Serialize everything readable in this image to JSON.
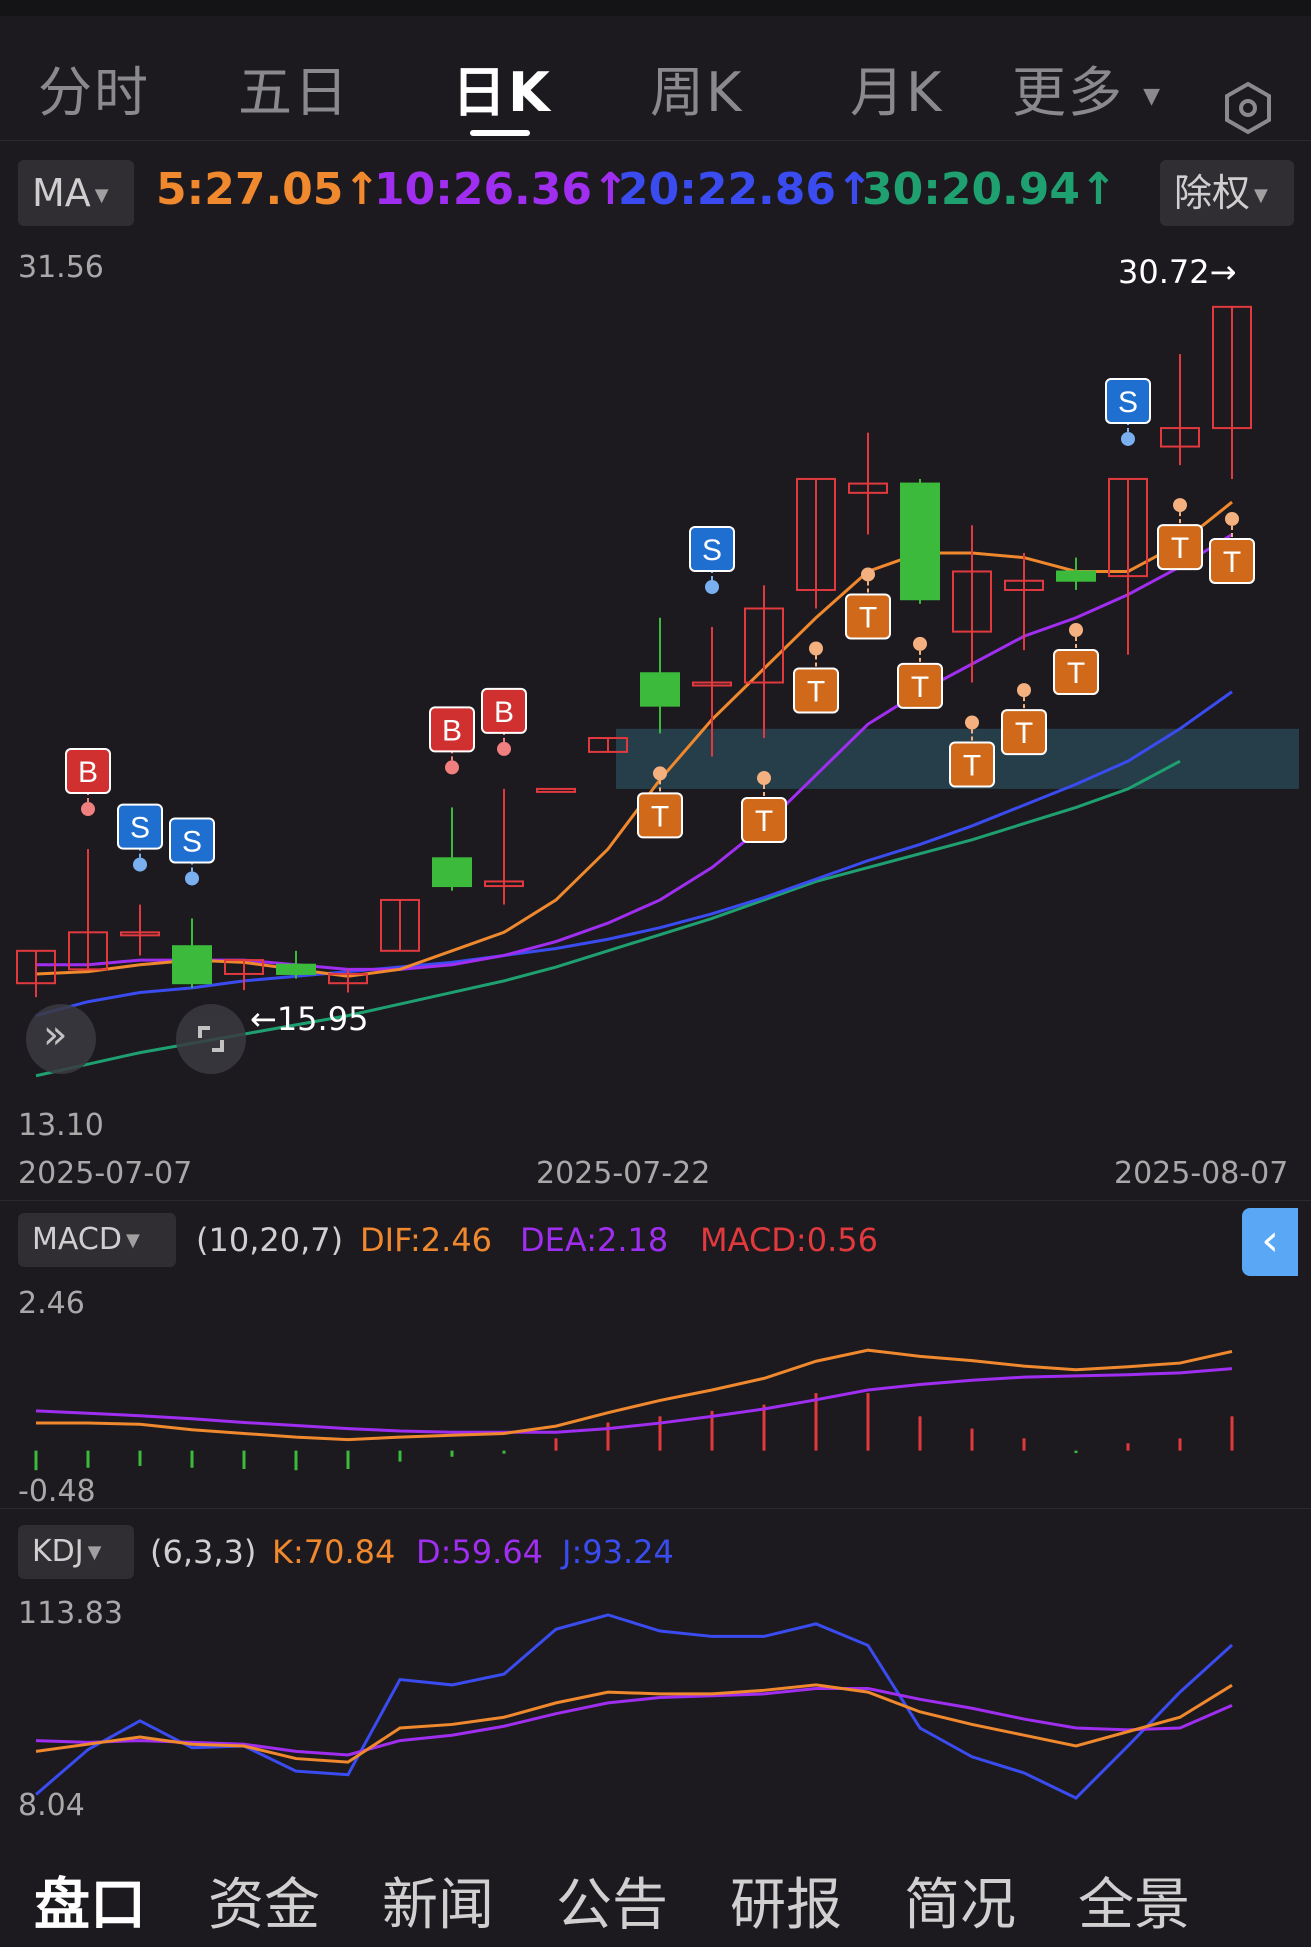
{
  "tabs": [
    "分时",
    "五日",
    "日K",
    "周K",
    "月K",
    "更多"
  ],
  "active_tab": "日K",
  "ma_selector": "MA",
  "adjust_selector": "除权",
  "ma_values": [
    {
      "label": "5:27.05↑",
      "color": "#f0882e"
    },
    {
      "label": "10:26.36↑",
      "color": "#a02ef0"
    },
    {
      "label": "20:22.86↑",
      "color": "#3a4cf0"
    },
    {
      "label": "30:20.94↑",
      "color": "#1fa070"
    }
  ],
  "price_axis": {
    "top": "31.56",
    "bottom": "13.10"
  },
  "high_label": "30.72→",
  "low_label": "←15.95",
  "dates": [
    "2025-07-07",
    "2025-07-22",
    "2025-08-07"
  ],
  "macd": {
    "selector": "MACD",
    "params": "(10,20,7)",
    "dif": "DIF:2.46",
    "dea": "DEA:2.18",
    "macd": "MACD:0.56",
    "axis_top": "2.46",
    "axis_bot": "-0.48"
  },
  "kdj": {
    "selector": "KDJ",
    "params": "(6,3,3)",
    "k": "K:70.84",
    "d": "D:59.64",
    "j": "J:93.24",
    "axis_top": "113.83",
    "axis_bot": "8.04"
  },
  "bottom_nav": [
    "盘口",
    "资金",
    "新闻",
    "公告",
    "研报",
    "简况",
    "全景"
  ],
  "colors": {
    "up": "#e0393e",
    "down": "#3cba3c",
    "ma5": "#f0882e",
    "ma10": "#a02ef0",
    "ma20": "#3a4cf0",
    "ma30": "#1fa070",
    "zone": "#27424e"
  },
  "chart_data": [
    {
      "type": "candlestick",
      "title": "",
      "ylim": [
        13.1,
        31.56
      ],
      "x_labels": [
        "2025-07-07",
        "2025-07-22",
        "2025-08-07"
      ],
      "candles": [
        {
          "o": 16.1,
          "c": 16.8,
          "h": 16.8,
          "l": 15.8,
          "dir": "up"
        },
        {
          "o": 16.4,
          "c": 17.2,
          "h": 19.0,
          "l": 16.4,
          "dir": "up"
        },
        {
          "o": 17.2,
          "c": 17.2,
          "h": 17.8,
          "l": 16.7,
          "dir": "flat"
        },
        {
          "o": 16.9,
          "c": 16.1,
          "h": 17.5,
          "l": 16.0,
          "dir": "down"
        },
        {
          "o": 16.6,
          "c": 16.3,
          "h": 16.6,
          "l": 15.95,
          "dir": "up"
        },
        {
          "o": 16.5,
          "c": 16.3,
          "h": 16.8,
          "l": 16.2,
          "dir": "down"
        },
        {
          "o": 16.3,
          "c": 16.1,
          "h": 16.4,
          "l": 15.9,
          "dir": "up"
        },
        {
          "o": 16.8,
          "c": 17.9,
          "h": 17.9,
          "l": 16.8,
          "dir": "up"
        },
        {
          "o": 18.2,
          "c": 18.8,
          "h": 19.9,
          "l": 18.1,
          "dir": "down"
        },
        {
          "o": 18.3,
          "c": 18.2,
          "h": 20.3,
          "l": 17.8,
          "dir": "up"
        },
        {
          "o": 20.3,
          "c": 20.3,
          "h": 20.3,
          "l": 20.3,
          "dir": "flat"
        },
        {
          "o": 21.1,
          "c": 21.4,
          "h": 21.4,
          "l": 21.1,
          "dir": "up"
        },
        {
          "o": 22.1,
          "c": 22.8,
          "h": 24.0,
          "l": 21.5,
          "dir": "down"
        },
        {
          "o": 22.6,
          "c": 22.6,
          "h": 23.8,
          "l": 21.0,
          "dir": "flat"
        },
        {
          "o": 22.6,
          "c": 24.2,
          "h": 24.7,
          "l": 21.4,
          "dir": "up"
        },
        {
          "o": 24.6,
          "c": 27.0,
          "h": 27.0,
          "l": 24.2,
          "dir": "up"
        },
        {
          "o": 26.7,
          "c": 26.9,
          "h": 28.0,
          "l": 25.8,
          "dir": "up"
        },
        {
          "o": 26.9,
          "c": 24.4,
          "h": 27.0,
          "l": 24.3,
          "dir": "down"
        },
        {
          "o": 23.7,
          "c": 25.0,
          "h": 26.0,
          "l": 22.6,
          "dir": "up"
        },
        {
          "o": 24.6,
          "c": 24.8,
          "h": 25.4,
          "l": 23.3,
          "dir": "up"
        },
        {
          "o": 24.8,
          "c": 25.0,
          "h": 25.3,
          "l": 24.6,
          "dir": "down"
        },
        {
          "o": 24.9,
          "c": 27.0,
          "h": 27.0,
          "l": 23.2,
          "dir": "up"
        },
        {
          "o": 27.7,
          "c": 28.1,
          "h": 29.7,
          "l": 27.3,
          "dir": "up"
        },
        {
          "o": 28.1,
          "c": 30.72,
          "h": 30.72,
          "l": 27.0,
          "dir": "up"
        }
      ],
      "ma5": [
        16.3,
        16.35,
        16.5,
        16.6,
        16.55,
        16.4,
        16.25,
        16.4,
        16.8,
        17.2,
        17.9,
        19.0,
        20.5,
        21.8,
        22.9,
        24.0,
        25.0,
        25.4,
        25.4,
        25.3,
        25.0,
        25.0,
        25.6,
        26.5
      ],
      "ma10": [
        16.5,
        16.5,
        16.6,
        16.6,
        16.6,
        16.5,
        16.4,
        16.4,
        16.5,
        16.7,
        17.0,
        17.4,
        17.9,
        18.6,
        19.5,
        20.6,
        21.7,
        22.4,
        23.0,
        23.6,
        24.0,
        24.5,
        25.1,
        25.8
      ],
      "ma20": [
        15.4,
        15.7,
        15.9,
        16.0,
        16.15,
        16.25,
        16.35,
        16.45,
        16.55,
        16.7,
        16.85,
        17.05,
        17.3,
        17.6,
        17.95,
        18.35,
        18.75,
        19.1,
        19.5,
        19.95,
        20.4,
        20.9,
        21.6,
        22.4
      ],
      "ma30": [
        14.1,
        14.35,
        14.6,
        14.8,
        15.0,
        15.2,
        15.4,
        15.65,
        15.9,
        16.15,
        16.45,
        16.8,
        17.15,
        17.5,
        17.9,
        18.3,
        18.6,
        18.9,
        19.2,
        19.55,
        19.9,
        20.3,
        20.9
      ],
      "signals": [
        {
          "i": 1,
          "label": "B",
          "kind": "buy"
        },
        {
          "i": 2,
          "label": "S",
          "kind": "sell"
        },
        {
          "i": 3,
          "label": "S",
          "kind": "sell"
        },
        {
          "i": 8,
          "label": "B",
          "kind": "buy"
        },
        {
          "i": 9,
          "label": "B",
          "kind": "buy"
        },
        {
          "i": 12,
          "label": "T",
          "kind": "t"
        },
        {
          "i": 13,
          "label": "S",
          "kind": "sell"
        },
        {
          "i": 14,
          "label": "T",
          "kind": "t"
        },
        {
          "i": 15,
          "label": "T",
          "kind": "t"
        },
        {
          "i": 16,
          "label": "T",
          "kind": "t"
        },
        {
          "i": 17,
          "label": "T",
          "kind": "t"
        },
        {
          "i": 18,
          "label": "T",
          "kind": "t"
        },
        {
          "i": 19,
          "label": "T",
          "kind": "t"
        },
        {
          "i": 20,
          "label": "T",
          "kind": "t"
        },
        {
          "i": 21,
          "label": "S",
          "kind": "sell"
        },
        {
          "i": 22,
          "label": "T",
          "kind": "t"
        },
        {
          "i": 23,
          "label": "T",
          "kind": "t"
        }
      ],
      "zone": [
        20.3,
        21.6
      ]
    },
    {
      "type": "macd",
      "ylim": [
        -0.48,
        2.46
      ],
      "dif": [
        0.45,
        0.45,
        0.43,
        0.34,
        0.28,
        0.22,
        0.18,
        0.22,
        0.25,
        0.28,
        0.4,
        0.62,
        0.82,
        0.99,
        1.18,
        1.46,
        1.64,
        1.54,
        1.47,
        1.38,
        1.32,
        1.37,
        1.43,
        1.62
      ],
      "dea": [
        0.65,
        0.61,
        0.57,
        0.52,
        0.46,
        0.41,
        0.36,
        0.32,
        0.3,
        0.3,
        0.3,
        0.36,
        0.45,
        0.56,
        0.68,
        0.83,
        0.99,
        1.08,
        1.15,
        1.2,
        1.22,
        1.24,
        1.27,
        1.34
      ],
      "hist": [
        -0.32,
        -0.28,
        -0.25,
        -0.28,
        -0.3,
        -0.32,
        -0.3,
        -0.18,
        -0.1,
        -0.05,
        0.2,
        0.46,
        0.56,
        0.65,
        0.75,
        0.94,
        0.94,
        0.56,
        0.36,
        0.2,
        -0.04,
        0.12,
        0.2,
        0.56
      ]
    },
    {
      "type": "kdj",
      "ylim": [
        8.04,
        113.83
      ],
      "k": [
        34,
        38,
        42,
        38,
        37,
        30,
        28,
        47,
        49,
        53,
        61,
        67,
        66,
        66,
        68,
        71,
        67,
        56,
        49,
        43,
        37,
        45,
        53,
        70.84
      ],
      "d": [
        40,
        39,
        40,
        39,
        38,
        34,
        32,
        40,
        43,
        48,
        55,
        61,
        64,
        65,
        66,
        69,
        69,
        63,
        58,
        52,
        47,
        46,
        47,
        59.64
      ],
      "j": [
        10,
        35,
        51,
        36,
        37,
        23,
        21,
        74,
        71,
        77,
        102,
        110,
        101,
        98,
        98,
        105,
        93,
        47,
        31,
        22,
        8.04,
        37,
        67,
        93.24
      ]
    }
  ]
}
